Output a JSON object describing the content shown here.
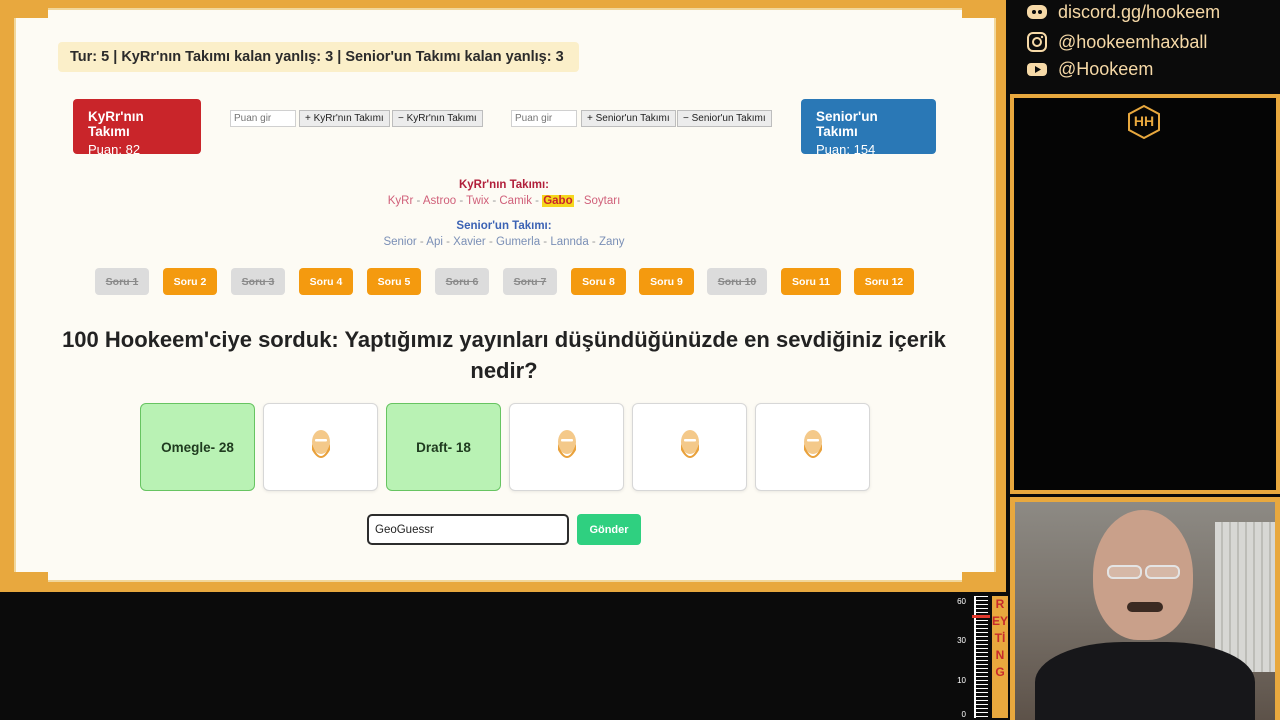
{
  "status": {
    "text": "Tur: 5 | KyRr'nın Takımı kalan yanlış: 3 | Senior'un Takımı kalan yanlış: 3"
  },
  "team_a": {
    "name": "KyRr'nın Takımı",
    "score_label": "Puan: 82",
    "input_placeholder": "Puan gir",
    "add_label": "+ KyRr'nın Takımı",
    "sub_label": "− KyRr'nın Takımı",
    "roster_title": "KyRr'nın Takımı:",
    "members": [
      "KyRr",
      "Astroo",
      "Twix",
      "Camik",
      "Gabo",
      "Soytarı"
    ],
    "highlighted_member": "Gabo",
    "color": "#c9252a"
  },
  "team_b": {
    "name": "Senior'un Takımı",
    "score_label": "Puan: 154",
    "input_placeholder": "Puan gir",
    "add_label": "+ Senior'un Takımı",
    "sub_label": "− Senior'un Takımı",
    "roster_title": "Senior'un Takımı:",
    "members": [
      "Senior",
      "Api",
      "Xavier",
      "Gumerla",
      "Lannda",
      "Zany"
    ],
    "color": "#2a78b6"
  },
  "separator": "-",
  "questions": [
    {
      "label": "Soru 1",
      "state": "done"
    },
    {
      "label": "Soru 2",
      "state": "active"
    },
    {
      "label": "Soru 3",
      "state": "done"
    },
    {
      "label": "Soru 4",
      "state": "active"
    },
    {
      "label": "Soru 5",
      "state": "active"
    },
    {
      "label": "Soru 6",
      "state": "done"
    },
    {
      "label": "Soru 7",
      "state": "done"
    },
    {
      "label": "Soru 8",
      "state": "active"
    },
    {
      "label": "Soru 9",
      "state": "active"
    },
    {
      "label": "Soru 10",
      "state": "done"
    },
    {
      "label": "Soru 11",
      "state": "active"
    },
    {
      "label": "Soru 12",
      "state": "active"
    }
  ],
  "question_text": "100 Hookeem'ciye sorduk: Yaptığımız yayınları düşündüğünüzde en sevdiğiniz içerik nedir?",
  "answers": [
    {
      "revealed": true,
      "text": "Omegle- 28"
    },
    {
      "revealed": false,
      "text": ""
    },
    {
      "revealed": true,
      "text": "Draft- 18"
    },
    {
      "revealed": false,
      "text": ""
    },
    {
      "revealed": false,
      "text": ""
    },
    {
      "revealed": false,
      "text": ""
    }
  ],
  "answer_input": {
    "value": "GeoGuessr"
  },
  "submit_label": "Gönder",
  "overlay": {
    "discord": "discord.gg/hookeem",
    "instagram": "@hookeemhaxball",
    "youtube": "@Hookeem",
    "logo_text": "HH",
    "rating_word": "REYTİNG",
    "rating_ticks": [
      "60",
      "30",
      "10",
      "0"
    ],
    "rating_value": 50
  },
  "colors": {
    "accent_orange": "#e8a83e",
    "question_active": "#f49a0f",
    "submit_green": "#2fd080"
  }
}
